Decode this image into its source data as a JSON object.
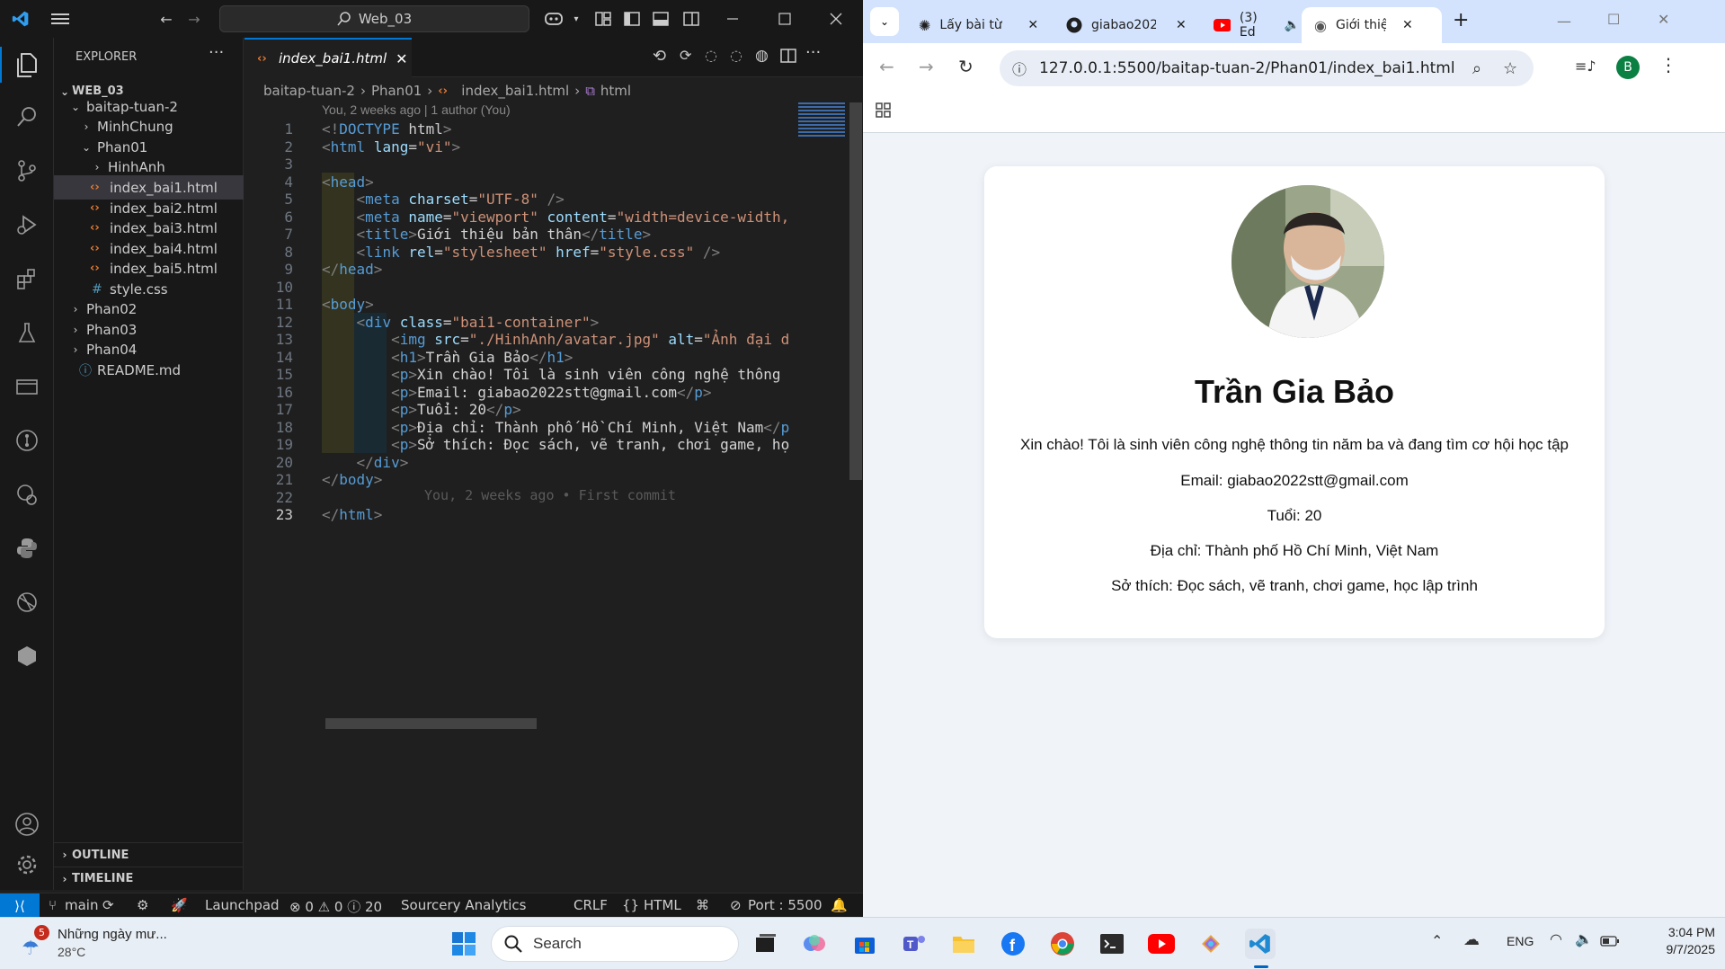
{
  "vscode": {
    "search_text": "Web_03",
    "explorer_title": "EXPLORER",
    "workspace": "WEB_03",
    "tree": [
      {
        "label": "baitap-tuan-2",
        "type": "folder-open"
      },
      {
        "label": "MinhChung",
        "type": "folder"
      },
      {
        "label": "Phan01",
        "type": "folder-open"
      },
      {
        "label": "HinhAnh",
        "type": "folder"
      },
      {
        "label": "index_bai1.html",
        "type": "html"
      },
      {
        "label": "index_bai2.html",
        "type": "html"
      },
      {
        "label": "index_bai3.html",
        "type": "html"
      },
      {
        "label": "index_bai4.html",
        "type": "html"
      },
      {
        "label": "index_bai5.html",
        "type": "html"
      },
      {
        "label": "style.css",
        "type": "css"
      },
      {
        "label": "Phan02",
        "type": "folder"
      },
      {
        "label": "Phan03",
        "type": "folder"
      },
      {
        "label": "Phan04",
        "type": "folder"
      },
      {
        "label": "README.md",
        "type": "info"
      }
    ],
    "outline": "OUTLINE",
    "timeline": "TIMELINE",
    "active_tab": "index_bai1.html",
    "breadcrumb": [
      "baitap-tuan-2",
      "Phan01",
      "index_bai1.html",
      "html"
    ],
    "blame_header": "You, 2 weeks ago | 1 author (You)",
    "code_lines": [
      "<!DOCTYPE html>",
      "<html lang=\"vi\">",
      "",
      "<head>",
      "    <meta charset=\"UTF-8\" />",
      "    <meta name=\"viewport\" content=\"width=device-width,",
      "    <title>Giới thiệu bản thân</title>",
      "    <link rel=\"stylesheet\" href=\"style.css\" />",
      "</head>",
      "",
      "<body>",
      "    <div class=\"bai1-container\">",
      "        <img src=\"./HinhAnh/avatar.jpg\" alt=\"Ảnh đại d",
      "        <h1>Trần Gia Bảo</h1>",
      "        <p>Xin chào! Tôi là sinh viên công nghệ thông t",
      "        <p>Email: giabao2022stt@gmail.com</p>",
      "        <p>Tuổi: 20</p>",
      "        <p>Địa chỉ: Thành phố Hồ Chí Minh, Việt Nam</p",
      "        <p>Sở thích: Đọc sách, vẽ tranh, chơi game, họ",
      "    </div>",
      "</body>",
      "",
      "</html>"
    ],
    "inline_blame": "You, 2 weeks ago • First commit",
    "status": {
      "branch": "main",
      "launchpad": "Launchpad",
      "errors": "0",
      "warnings": "0",
      "infos": "20",
      "sourcery": "Sourcery Analytics",
      "eol": "CRLF",
      "language": "HTML",
      "port": "Port : 5500"
    }
  },
  "browser": {
    "tabs": [
      {
        "title": "Lấy bài từ"
      },
      {
        "title": "giabao202"
      },
      {
        "title": "(3) Ed"
      },
      {
        "title": "Giới thiệu"
      }
    ],
    "url": "127.0.0.1:5500/baitap-tuan-2/Phan01/index_bai1.html",
    "profile_initial": "B",
    "profile": {
      "name": "Trần Gia Bảo",
      "intro": "Xin chào! Tôi là sinh viên công nghệ thông tin năm ba và đang tìm cơ hội học tập",
      "email": "Email: giabao2022stt@gmail.com",
      "age": "Tuổi: 20",
      "address": "Địa chỉ: Thành phố Hồ Chí Minh, Việt Nam",
      "hobbies": "Sở thích: Đọc sách, vẽ tranh, chơi game, học lập trình"
    }
  },
  "taskbar": {
    "weather_title": "Những ngày mư...",
    "weather_temp": "28°C",
    "weather_badge": "5",
    "search_label": "Search",
    "lang": "ENG",
    "time": "3:04 PM",
    "date": "9/7/2025"
  }
}
